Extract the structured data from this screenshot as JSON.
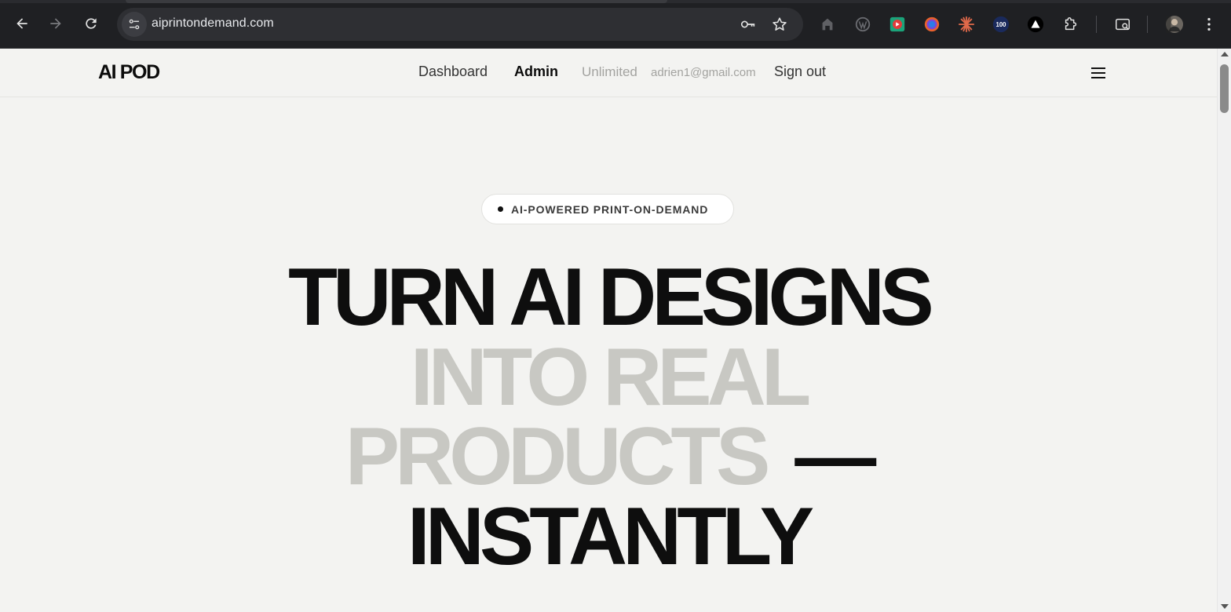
{
  "browser": {
    "url": "aiprintondemand.com",
    "extensions": [
      "home-icon",
      "wordpress-icon",
      "video-play-icon",
      "color-wheel-icon",
      "sparkle-icon",
      "100-badge-icon",
      "triangle-icon",
      "puzzle-extensions-icon"
    ],
    "badge_100": "100"
  },
  "header": {
    "logo": "AI POD",
    "nav": {
      "dashboard": "Dashboard",
      "admin": "Admin"
    },
    "plan": "Unlimited",
    "email": "adrien1@gmail.com",
    "signout": "Sign out"
  },
  "hero": {
    "badge": "AI-POWERED PRINT-ON-DEMAND",
    "line1": "TURN AI DESIGNS",
    "line2": "INTO REAL",
    "line3_light": "PRODUCTS",
    "line3_dash": "—",
    "line4": "INSTANTLY"
  },
  "colors": {
    "chrome_bg": "#1f2023",
    "page_bg": "#f3f3f1",
    "text_dark": "#0e0e0e",
    "text_light": "#c8c8c3",
    "muted": "#a3a3a0"
  }
}
